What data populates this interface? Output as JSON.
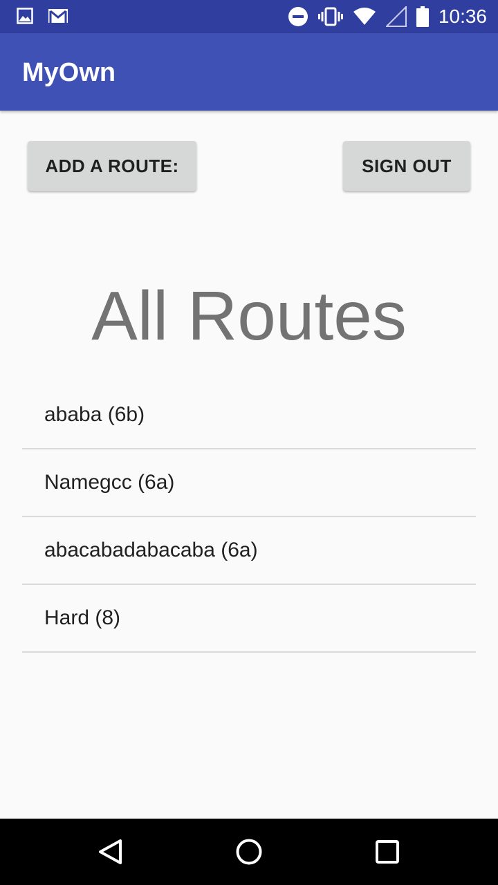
{
  "status_bar": {
    "time": "10:36",
    "icons": [
      "gallery-icon",
      "gmail-icon",
      "do-not-disturb-icon",
      "vibrate-icon",
      "wifi-icon",
      "cell-signal-icon",
      "battery-icon"
    ]
  },
  "app_bar": {
    "title": "MyOwn"
  },
  "actions": {
    "add_route_label": "ADD A ROUTE:",
    "sign_out_label": "SIGN OUT"
  },
  "main": {
    "title": "All Routes",
    "routes": [
      {
        "label": "ababa (6b)"
      },
      {
        "label": "Namegcc (6a)"
      },
      {
        "label": "abacabadabacaba (6a)"
      },
      {
        "label": "Hard (8)"
      }
    ]
  },
  "nav_bar": {
    "icons": [
      "back-icon",
      "home-icon",
      "recents-icon"
    ]
  },
  "colors": {
    "status_bar": "#303f9f",
    "app_bar": "#3f51b5",
    "background": "#fafafa",
    "button": "#d6d7d7",
    "title_text": "#737373",
    "divider": "#dadada"
  }
}
